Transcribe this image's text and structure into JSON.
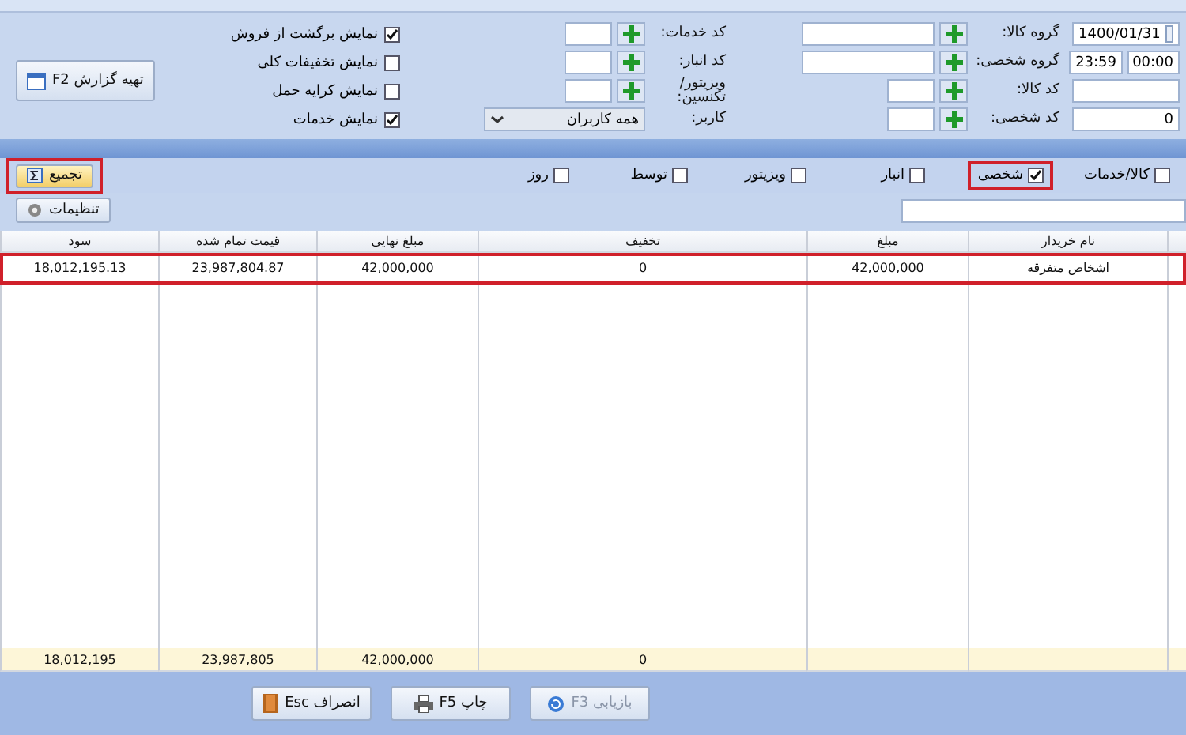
{
  "form": {
    "date": "1400/01/31",
    "time_from": "00:00",
    "time_to": "23:59",
    "person_code_value": "0",
    "lookups": [
      {
        "label": "گروه کالا:",
        "wide": true
      },
      {
        "label": "گروه شخصی:",
        "wide": true
      },
      {
        "label": "کد کالا:",
        "wide": false
      },
      {
        "label": "کد شخصی:",
        "wide": false
      }
    ],
    "lookups_2": [
      {
        "label": "کد خدمات:",
        "kind": "lookup"
      },
      {
        "label": "کد انبار:",
        "kind": "lookup"
      },
      {
        "label": "ویزیتور/ تکنسین:",
        "kind": "lookup"
      },
      {
        "label": "کاربر:",
        "kind": "select",
        "value": "همه کاربران"
      }
    ],
    "options": [
      {
        "label": "نمایش برگشت از فروش",
        "checked": true
      },
      {
        "label": "نمایش تخفیفات کلی",
        "checked": false
      },
      {
        "label": "نمایش کرایه حمل",
        "checked": false
      },
      {
        "label": "نمایش خدمات",
        "checked": true
      }
    ],
    "report_button": "تهیه گزارش F2"
  },
  "group_by": [
    {
      "label": "کالا/خدمات",
      "checked": false,
      "highlighted": false
    },
    {
      "label": "شخصی",
      "checked": true,
      "highlighted": true
    },
    {
      "label": "انبار",
      "checked": false,
      "highlighted": false
    },
    {
      "label": "ویزیتور",
      "checked": false,
      "highlighted": false
    },
    {
      "label": "توسط",
      "checked": false,
      "highlighted": false
    },
    {
      "label": "روز",
      "checked": false,
      "highlighted": false
    }
  ],
  "merge_button": {
    "label": "تجمیع",
    "highlighted": true
  },
  "settings_button": "تنظیمات",
  "table": {
    "columns": [
      "نام خریدار",
      "مبلغ",
      "تخفیف",
      "مبلغ نهایی",
      "قیمت تمام شده",
      "سود"
    ],
    "rows": [
      {
        "cells": [
          "اشخاص متفرقه",
          "42,000,000",
          "0",
          "42,000,000",
          "23,987,804.87",
          "18,012,195.13"
        ],
        "highlighted": true
      }
    ],
    "totals": [
      "0",
      "42,000,000",
      "23,987,805",
      "18,012,195"
    ]
  },
  "buttons": [
    {
      "label": "بازیابی F3",
      "disabled": true,
      "kind": "restore"
    },
    {
      "label": "چاپ F5",
      "disabled": false,
      "kind": "print"
    },
    {
      "label": "انصراف Esc",
      "disabled": false,
      "kind": "cancel"
    }
  ]
}
